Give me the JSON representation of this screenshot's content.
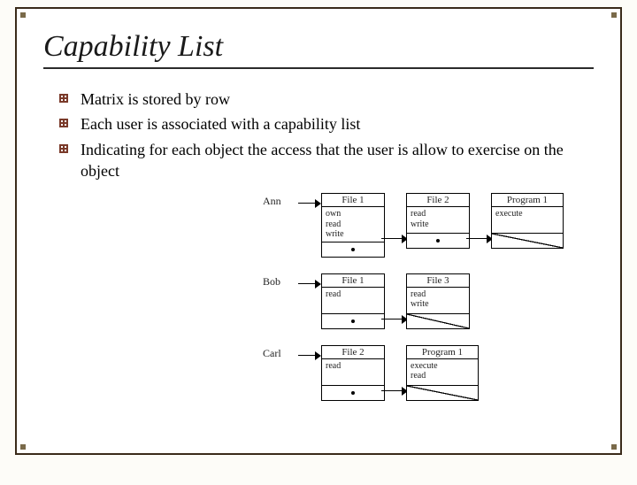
{
  "title": "Capability List",
  "bullets": [
    "Matrix is stored by row",
    "Each user is associated with a capability list",
    "Indicating for each object the access that the user is allow to exercise on the object"
  ],
  "diagram": {
    "rows": [
      {
        "user": "Ann",
        "nodes": [
          {
            "header": "File 1",
            "rights": [
              "own",
              "read",
              "write"
            ],
            "terminal": false
          },
          {
            "header": "File 2",
            "rights": [
              "read",
              "write"
            ],
            "terminal": false
          },
          {
            "header": "Program 1",
            "rights": [
              "execute"
            ],
            "terminal": true,
            "wide": true
          }
        ]
      },
      {
        "user": "Bob",
        "nodes": [
          {
            "header": "File 1",
            "rights": [
              "read"
            ],
            "terminal": false
          },
          {
            "header": "File 3",
            "rights": [
              "read",
              "write"
            ],
            "terminal": true
          }
        ]
      },
      {
        "user": "Carl",
        "nodes": [
          {
            "header": "File 2",
            "rights": [
              "read"
            ],
            "terminal": false
          },
          {
            "header": "Program 1",
            "rights": [
              "execute",
              "read"
            ],
            "terminal": true,
            "wide": true
          }
        ]
      }
    ]
  }
}
